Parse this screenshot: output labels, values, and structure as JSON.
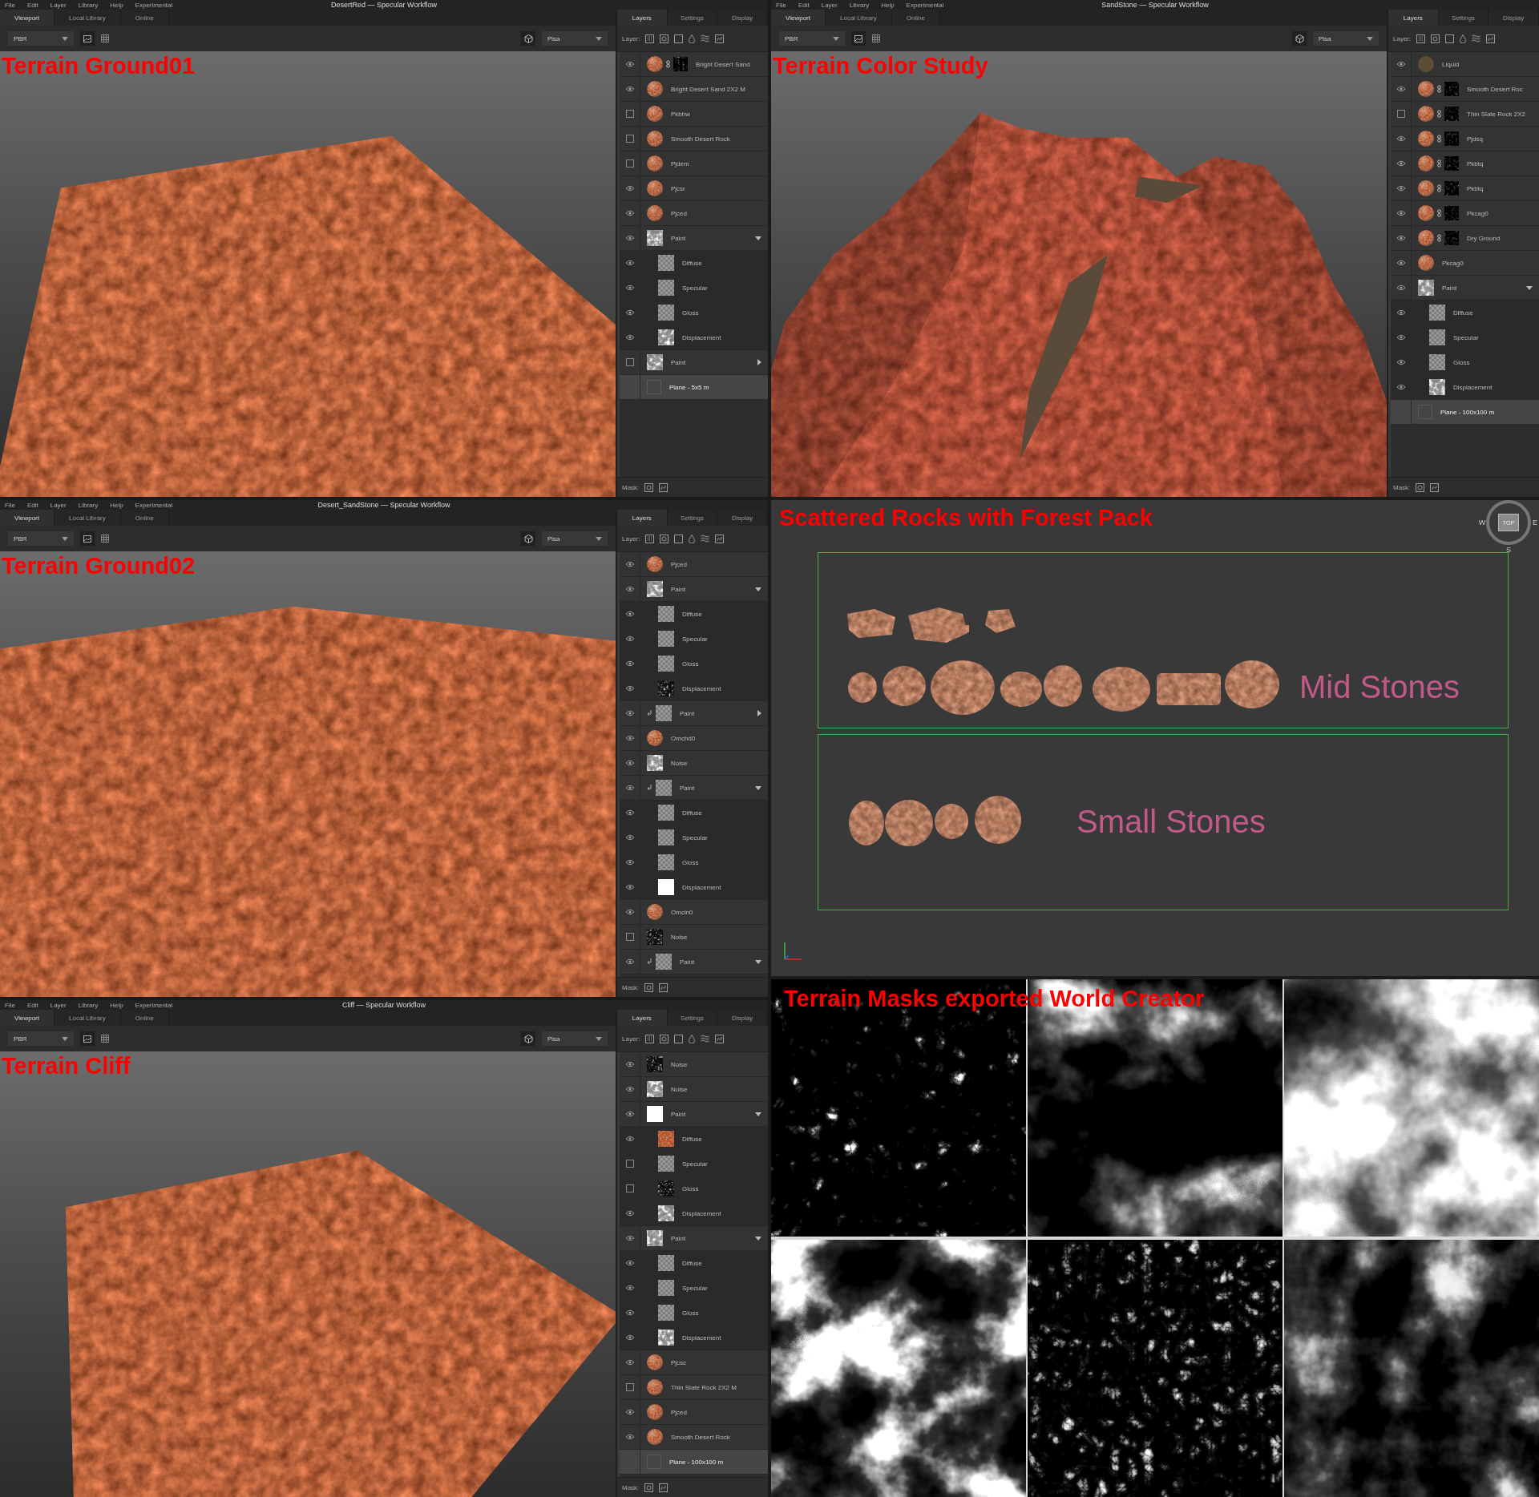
{
  "columns": [
    {
      "panels": [
        {
          "kind": "app",
          "title": "DesertRed — Specular Workflow",
          "menu": [
            "File",
            "Edit",
            "Layer",
            "Library",
            "Help",
            "Experimental"
          ],
          "view_tabs": [
            {
              "label": "Viewport",
              "selected": true
            },
            {
              "label": "Local Library",
              "selected": false
            },
            {
              "label": "Online",
              "selected": false
            }
          ],
          "render_mode": "PBR",
          "environment": "Pisa",
          "viewport": {
            "kind": "tile",
            "caption": "Terrain Ground01"
          },
          "panel_tabs": [
            {
              "label": "Layers",
              "selected": true
            },
            {
              "label": "Settings",
              "selected": false
            },
            {
              "label": "Display",
              "selected": false
            }
          ],
          "layer_label": "Layer:",
          "layers": [
            {
              "name": "Bright Desert Sand",
              "visible": true,
              "kind": "masked"
            },
            {
              "name": "Bright Desert Sand 2X2 M",
              "visible": true,
              "kind": "material"
            },
            {
              "name": "Pkbhw",
              "visible": false,
              "kind": "material"
            },
            {
              "name": "Smooth Desert Rock",
              "visible": false,
              "kind": "material"
            },
            {
              "name": "Pjdem",
              "visible": false,
              "kind": "material"
            },
            {
              "name": "Pjcsr",
              "visible": true,
              "kind": "material"
            },
            {
              "name": "Pjced",
              "visible": true,
              "kind": "material"
            },
            {
              "name": "Paint",
              "visible": true,
              "kind": "paint",
              "expanded": true,
              "children": [
                {
                  "name": "Diffuse",
                  "visible": true,
                  "kind": "checker"
                },
                {
                  "name": "Specular",
                  "visible": true,
                  "kind": "checker"
                },
                {
                  "name": "Gloss",
                  "visible": true,
                  "kind": "checker"
                },
                {
                  "name": "Displacement",
                  "visible": true,
                  "kind": "paint"
                }
              ]
            },
            {
              "name": "Paint",
              "visible": false,
              "kind": "paint",
              "expanded": false
            }
          ],
          "base_layer": {
            "name": "Plane - 5x5 m",
            "selected": true
          },
          "mask_label": "Mask:"
        },
        {
          "kind": "app",
          "title": "Desert_SandStone — Specular Workflow",
          "menu": [
            "File",
            "Edit",
            "Layer",
            "Library",
            "Help",
            "Experimental"
          ],
          "view_tabs": [
            {
              "label": "Viewport",
              "selected": true
            },
            {
              "label": "Local Library",
              "selected": false
            },
            {
              "label": "Online",
              "selected": false
            }
          ],
          "render_mode": "PBR",
          "environment": "Pisa",
          "viewport": {
            "kind": "ground",
            "caption": "Terrain Ground02"
          },
          "panel_tabs": [
            {
              "label": "Layers",
              "selected": true
            },
            {
              "label": "Settings",
              "selected": false
            },
            {
              "label": "Display",
              "selected": false
            }
          ],
          "layer_label": "Layer:",
          "layers": [
            {
              "name": "Pjced",
              "visible": true,
              "kind": "material"
            },
            {
              "name": "Paint",
              "visible": true,
              "kind": "paint",
              "expanded": true,
              "children": [
                {
                  "name": "Diffuse",
                  "visible": true,
                  "kind": "checker"
                },
                {
                  "name": "Specular",
                  "visible": true,
                  "kind": "checker"
                },
                {
                  "name": "Gloss",
                  "visible": true,
                  "kind": "checker"
                },
                {
                  "name": "Displacement",
                  "visible": true,
                  "kind": "noise"
                }
              ]
            },
            {
              "name": "Paint",
              "visible": true,
              "kind": "checker",
              "clipped": true,
              "expanded": false
            },
            {
              "name": "Omchd0",
              "visible": true,
              "kind": "material"
            },
            {
              "name": "Noise",
              "visible": true,
              "kind": "paint"
            },
            {
              "name": "Paint",
              "visible": true,
              "kind": "checker",
              "clipped": true,
              "expanded": true,
              "children": [
                {
                  "name": "Diffuse",
                  "visible": true,
                  "kind": "checker"
                },
                {
                  "name": "Specular",
                  "visible": true,
                  "kind": "checker"
                },
                {
                  "name": "Gloss",
                  "visible": true,
                  "kind": "checker"
                },
                {
                  "name": "Displacement",
                  "visible": true,
                  "kind": "solid"
                }
              ]
            },
            {
              "name": "Omcin0",
              "visible": true,
              "kind": "material"
            },
            {
              "name": "Noise",
              "visible": false,
              "kind": "noise"
            },
            {
              "name": "Paint",
              "visible": true,
              "kind": "checker",
              "clipped": true,
              "expanded": true
            }
          ],
          "mask_label": "Mask:"
        },
        {
          "kind": "app",
          "title": "Cliff — Specular Workflow",
          "menu": [
            "File",
            "Edit",
            "Layer",
            "Library",
            "Help",
            "Experimental"
          ],
          "view_tabs": [
            {
              "label": "Viewport",
              "selected": true
            },
            {
              "label": "Local Library",
              "selected": false
            },
            {
              "label": "Online",
              "selected": false
            }
          ],
          "render_mode": "PBR",
          "environment": "Pisa",
          "viewport": {
            "kind": "cliff",
            "caption": "Terrain Cliff"
          },
          "panel_tabs": [
            {
              "label": "Layers",
              "selected": true
            },
            {
              "label": "Settings",
              "selected": false
            },
            {
              "label": "Display",
              "selected": false
            }
          ],
          "layer_label": "Layer:",
          "layers": [
            {
              "name": "Noise",
              "visible": true,
              "kind": "noise"
            },
            {
              "name": "Noise",
              "visible": true,
              "kind": "paint"
            },
            {
              "name": "Paint",
              "visible": true,
              "kind": "solid",
              "expanded": true,
              "children": [
                {
                  "name": "Diffuse",
                  "visible": true,
                  "kind": "texture"
                },
                {
                  "name": "Specular",
                  "visible": false,
                  "kind": "checker"
                },
                {
                  "name": "Gloss",
                  "visible": false,
                  "kind": "noise"
                },
                {
                  "name": "Displacement",
                  "visible": true,
                  "kind": "paint"
                }
              ]
            },
            {
              "name": "Paint",
              "visible": true,
              "kind": "paint",
              "expanded": true,
              "children": [
                {
                  "name": "Diffuse",
                  "visible": true,
                  "kind": "checker"
                },
                {
                  "name": "Specular",
                  "visible": true,
                  "kind": "checker"
                },
                {
                  "name": "Gloss",
                  "visible": true,
                  "kind": "checker"
                },
                {
                  "name": "Displacement",
                  "visible": true,
                  "kind": "paint"
                }
              ]
            },
            {
              "name": "Pjcsc",
              "visible": true,
              "kind": "material"
            },
            {
              "name": "Thin Slate Rock 2X2 M",
              "visible": false,
              "kind": "material"
            },
            {
              "name": "Pjced",
              "visible": true,
              "kind": "material"
            },
            {
              "name": "Smooth Desert Rock",
              "visible": true,
              "kind": "material"
            }
          ],
          "base_layer": {
            "name": "Plane - 100x100 m",
            "selected": true
          },
          "mask_label": "Mask:"
        }
      ]
    },
    {
      "panels": [
        {
          "kind": "app",
          "title": "SandStone — Specular Workflow",
          "menu": [
            "File",
            "Edit",
            "Layer",
            "Library",
            "Help",
            "Experimental"
          ],
          "view_tabs": [
            {
              "label": "Viewport",
              "selected": true
            },
            {
              "label": "Local Library",
              "selected": false
            },
            {
              "label": "Online",
              "selected": false
            }
          ],
          "render_mode": "PBR",
          "environment": "Pisa",
          "viewport": {
            "kind": "mountain",
            "caption": "Terrain Color Study"
          },
          "panel_tabs": [
            {
              "label": "Layers",
              "selected": true
            },
            {
              "label": "Settings",
              "selected": false
            },
            {
              "label": "Display",
              "selected": false
            }
          ],
          "layer_label": "Layer:",
          "layers": [
            {
              "name": "Liquid",
              "visible": true,
              "kind": "fill"
            },
            {
              "name": "Smooth Desert Roc",
              "visible": true,
              "kind": "masked"
            },
            {
              "name": "Thin Slate Rock 2X2",
              "visible": false,
              "kind": "masked"
            },
            {
              "name": "Pjdsq",
              "visible": true,
              "kind": "masked"
            },
            {
              "name": "Pkbtq",
              "visible": true,
              "kind": "masked"
            },
            {
              "name": "Pkbtq",
              "visible": true,
              "kind": "masked"
            },
            {
              "name": "Pkcag0",
              "visible": true,
              "kind": "masked"
            },
            {
              "name": "Dry Ground",
              "visible": true,
              "kind": "masked"
            },
            {
              "name": "Pkcag0",
              "visible": true,
              "kind": "material"
            },
            {
              "name": "Paint",
              "visible": true,
              "kind": "paint",
              "expanded": true,
              "children": [
                {
                  "name": "Diffuse",
                  "visible": true,
                  "kind": "checker"
                },
                {
                  "name": "Specular",
                  "visible": true,
                  "kind": "checker"
                },
                {
                  "name": "Gloss",
                  "visible": true,
                  "kind": "checker"
                },
                {
                  "name": "Displacement",
                  "visible": true,
                  "kind": "paint"
                }
              ]
            }
          ],
          "base_layer": {
            "name": "Plane - 100x100 m",
            "selected": true
          },
          "mask_label": "Mask:"
        },
        {
          "kind": "scatter",
          "caption": "Scattered Rocks with Forest Pack",
          "compass": {
            "west": "W",
            "top": "TOP",
            "east": "E",
            "south": "S"
          },
          "groups": [
            {
              "kind": "mid",
              "label": "Mid Stones"
            },
            {
              "kind": "small",
              "label": "Small Stones"
            }
          ]
        },
        {
          "kind": "masks",
          "caption": "Terrain Masks exported World Creator"
        }
      ]
    }
  ]
}
